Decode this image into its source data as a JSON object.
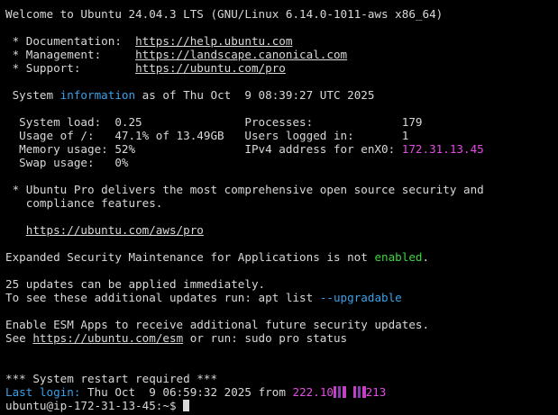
{
  "welcome": "Welcome to Ubuntu 24.04.3 LTS (GNU/Linux 6.14.0-1011-aws x86_64)",
  "links": {
    "doc_label": " * Documentation:  ",
    "doc_url": "https://help.ubuntu.com",
    "mgmt_label": " * Management:     ",
    "mgmt_url": "https://landscape.canonical.com",
    "support_label": " * Support:        ",
    "support_url": "https://ubuntu.com/pro"
  },
  "sysinfo": {
    "pre": " System ",
    "word": "information",
    "post": " as of Thu Oct  9 08:39:27 UTC 2025"
  },
  "stats": {
    "row1": "  System load:  0.25               Processes:             179",
    "row2": "  Usage of /:   47.1% of 13.49GB   Users logged in:       1",
    "row3_left": "  Memory usage: 52%                IPv4 address for enX0: ",
    "row3_ip": "172.31.13.45",
    "row4": "  Swap usage:   0%"
  },
  "pro": {
    "line1": " * Ubuntu Pro delivers the most comprehensive open source security and",
    "line2": "   compliance features.",
    "url_indent": "   ",
    "url": "https://ubuntu.com/aws/pro"
  },
  "esm": {
    "pre": "Expanded Security Maintenance for Applications is not ",
    "status": "enabled",
    "post": "."
  },
  "updates": {
    "line1": "25 updates can be applied immediately.",
    "line2_pre": "To see these additional updates run: apt list ",
    "line2_flag": "--upgradable"
  },
  "esm_apps": {
    "line1": "Enable ESM Apps to receive additional future security updates.",
    "line2_pre": "See ",
    "line2_url": "https://ubuntu.com/esm",
    "line2_post": " or run: sudo pro status"
  },
  "restart": "*** System restart required ***",
  "last_login": {
    "label": "Last login: ",
    "date": "Thu Oct  9 06:59:32 2025",
    "from": " from ",
    "ip_start": "222.10",
    "ip_end": "213"
  },
  "prompt": "ubuntu@ip-172-31-13-45:~$ ",
  "colors": {
    "background": "#000000",
    "text": "#d8d8d8",
    "blue": "#3aa0e8",
    "green": "#3fd43f",
    "magenta": "#e54be5"
  }
}
